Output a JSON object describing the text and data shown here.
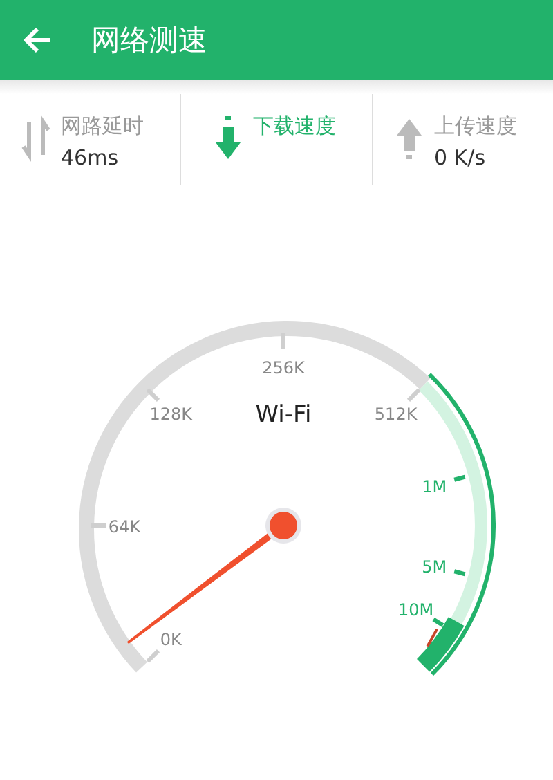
{
  "header": {
    "title": "网络测速"
  },
  "stats": [
    {
      "kind": "latency",
      "label": "网路延时",
      "value": "46ms",
      "selected": false
    },
    {
      "kind": "download",
      "label": "下载速度",
      "selected": true
    },
    {
      "kind": "upload",
      "label": "上传速度",
      "value": "0 K/s",
      "selected": false
    }
  ],
  "gauge": {
    "network": "Wi-Fi",
    "ticks": [
      "0K",
      "64K",
      "128K",
      "256K",
      "512K",
      "1M",
      "5M",
      "10M"
    ]
  }
}
